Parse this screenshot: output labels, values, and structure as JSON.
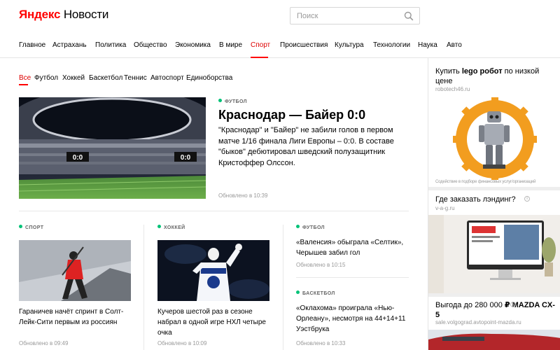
{
  "header": {
    "logo_red": "Яндекс",
    "logo_black": "Новости",
    "search_placeholder": "Поиск"
  },
  "nav": {
    "items": [
      {
        "label": "Главное"
      },
      {
        "label": "Астрахань"
      },
      {
        "label": "Политика"
      },
      {
        "label": "Общество"
      },
      {
        "label": "Экономика"
      },
      {
        "label": "В мире"
      },
      {
        "label": "Спорт",
        "active": true
      },
      {
        "label": "Происшествия"
      },
      {
        "label": "Культура"
      },
      {
        "label": "Технологии"
      },
      {
        "label": "Наука"
      },
      {
        "label": "Авто"
      }
    ]
  },
  "subnav": {
    "items": [
      {
        "label": "Все",
        "active": true
      },
      {
        "label": "Футбол"
      },
      {
        "label": "Хоккей"
      },
      {
        "label": "Баскетбол"
      },
      {
        "label": "Теннис"
      },
      {
        "label": "Автоспорт"
      },
      {
        "label": "Единоборства"
      }
    ]
  },
  "main_story": {
    "tag": "ФУТБОЛ",
    "title": "Краснодар — Байер 0:0",
    "text": "\"Краснодар\" и \"Байер\" не забили голов в первом матче 1/16 финала Лиги Европы – 0:0. В составе \"быков\" дебютировал шведский полузащитник Кристоффер Олссон.",
    "updated": "Обновлено в 10:39",
    "scoreboard_left": "0:0",
    "scoreboard_right": "0:0"
  },
  "stories": [
    {
      "tag": "СПОРТ",
      "title": "Гараничев начёт спринт в Солт-Лейк-Сити первым из россиян",
      "updated": "Обновлено в 09:49"
    },
    {
      "tag": "ХОККЕЙ",
      "title": "Кучеров шестой раз в сезоне набрал в одной игре НХЛ четыре очка",
      "updated": "Обновлено в 10:09"
    },
    {
      "tag": "ФУТБОЛ",
      "title": "«Валенсия» обыграла «Селтик», Черышев забил гол",
      "updated": "Обновлено в 10:15"
    },
    {
      "tag": "БАСКЕТБОЛ",
      "title": "«Оклахома» проиграла «Нью-Орлеану», несмотря на 44+14+11 Уэстбрука",
      "updated": "Обновлено в 10:33"
    }
  ],
  "ads": [
    {
      "title_pre": "Купить ",
      "title_bold": "lego робот",
      "title_post": " по низкой цене",
      "url": "robotech46.ru",
      "caption": "Содействие в подборе финансовых услуг/организаций"
    },
    {
      "title": "Где заказать лэндинг?",
      "url": "v-a-g.ru"
    },
    {
      "title_pre": "Выгода до 280 000 ",
      "title_bold": "₽ MAZDA CX-5",
      "url": "sale.volgograd.avtopoint-mazda.ru"
    }
  ],
  "colors": {
    "accent_red": "#ff0000",
    "tag_green": "#00c277",
    "meta_gray": "#999999"
  }
}
